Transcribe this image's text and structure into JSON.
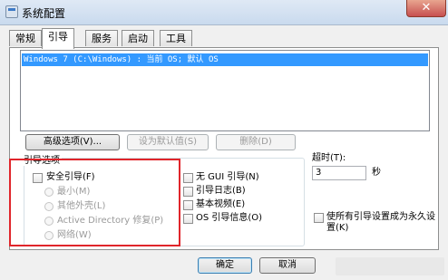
{
  "window": {
    "title": "系统配置",
    "close_glyph": "✕"
  },
  "tabs": [
    "常规",
    "引导",
    "服务",
    "启动",
    "工具"
  ],
  "os_list": {
    "entry": "Windows 7 (C:\\Windows) : 当前 OS; 默认 OS"
  },
  "buttons": {
    "advanced": "高级选项(V)...",
    "set_default": "设为默认值(S)",
    "delete": "删除(D)",
    "ok": "确定",
    "cancel": "取消"
  },
  "boot_options": {
    "label": "引导选项",
    "safe_boot": "安全引导(F)",
    "minimal": "最小(M)",
    "alternate_shell": "其他外壳(L)",
    "active_directory": "Active Directory 修复(P)",
    "network": "网络(W)",
    "no_gui": "无 GUI 引导(N)",
    "boot_log": "引导日志(B)",
    "base_video": "基本视频(E)",
    "os_boot_info": "OS 引导信息(O)"
  },
  "timeout": {
    "label": "超时(T):",
    "value": "3",
    "unit": "秒"
  },
  "make_permanent": "使所有引导设置成为永久设置(K)",
  "colors": {
    "selection": "#3399ff",
    "highlight_border": "#e0252b"
  }
}
